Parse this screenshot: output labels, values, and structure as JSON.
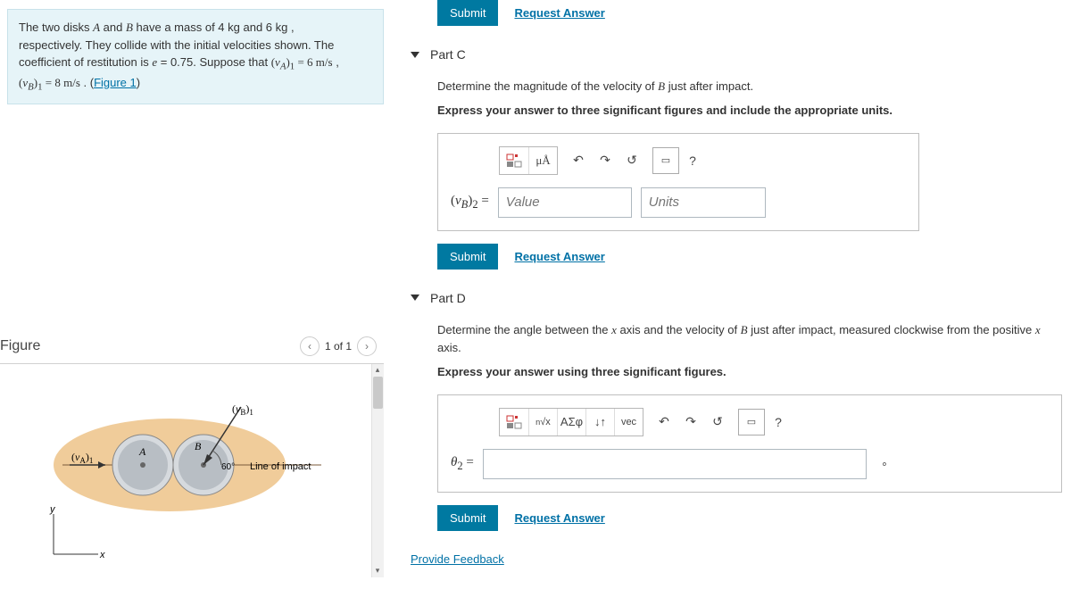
{
  "prompt": {
    "line1_a": "The two disks ",
    "A": "A",
    "line1_b": " and ",
    "B": "B",
    "line1_c": " have a mass of 4  kg and 6  kg ,",
    "line2": "respectively. They collide with the initial velocities shown. The",
    "line3_a": "coefficient of restitution is ",
    "e_eq": "e = 0.75",
    "line3_b": ". Suppose that ",
    "vA1": "(v_A)₁ = 6  m/s",
    "comma": " ,",
    "vB1": "(v_B)₁ = 8  m/s",
    "period": " . (",
    "fig_link": "Figure 1",
    "paren_close": ")"
  },
  "figure": {
    "title": "Figure",
    "pager": "1 of 1",
    "labels": {
      "vA1": "(v_A)₁",
      "vB1": "(v_B)₁",
      "A": "A",
      "B": "B",
      "angle": "60°",
      "line_of_impact": "Line of impact",
      "x": "x",
      "y": "y"
    }
  },
  "top": {
    "submit": "Submit",
    "request": "Request Answer"
  },
  "partC": {
    "label": "Part C",
    "instr1": "Determine the magnitude of the velocity of B just after impact.",
    "instr2": "Express your answer to three significant figures and include the appropriate units.",
    "toolbar": {
      "templates": "templates",
      "muA": "μÅ",
      "undo": "↶",
      "redo": "↷",
      "reset": "↺",
      "keyboard": "⌨",
      "help": "?"
    },
    "eq_label": "(v_B)₂ =",
    "value_ph": "Value",
    "units_ph": "Units",
    "submit": "Submit",
    "request": "Request Answer"
  },
  "partD": {
    "label": "Part D",
    "instr1": "Determine the angle between the x axis and the velocity of B just after impact, measured clockwise from the positive x axis.",
    "instr2": "Express your answer using three significant figures.",
    "toolbar": {
      "templates": "templates",
      "sqrt": "ⁿ√x",
      "greek": "ΑΣφ",
      "updown": "↓↑",
      "vec": "vec",
      "undo": "↶",
      "redo": "↷",
      "reset": "↺",
      "keyboard": "⌨",
      "help": "?"
    },
    "eq_label": "θ₂ =",
    "deg": "∘",
    "submit": "Submit",
    "request": "Request Answer"
  },
  "feedback": "Provide Feedback"
}
